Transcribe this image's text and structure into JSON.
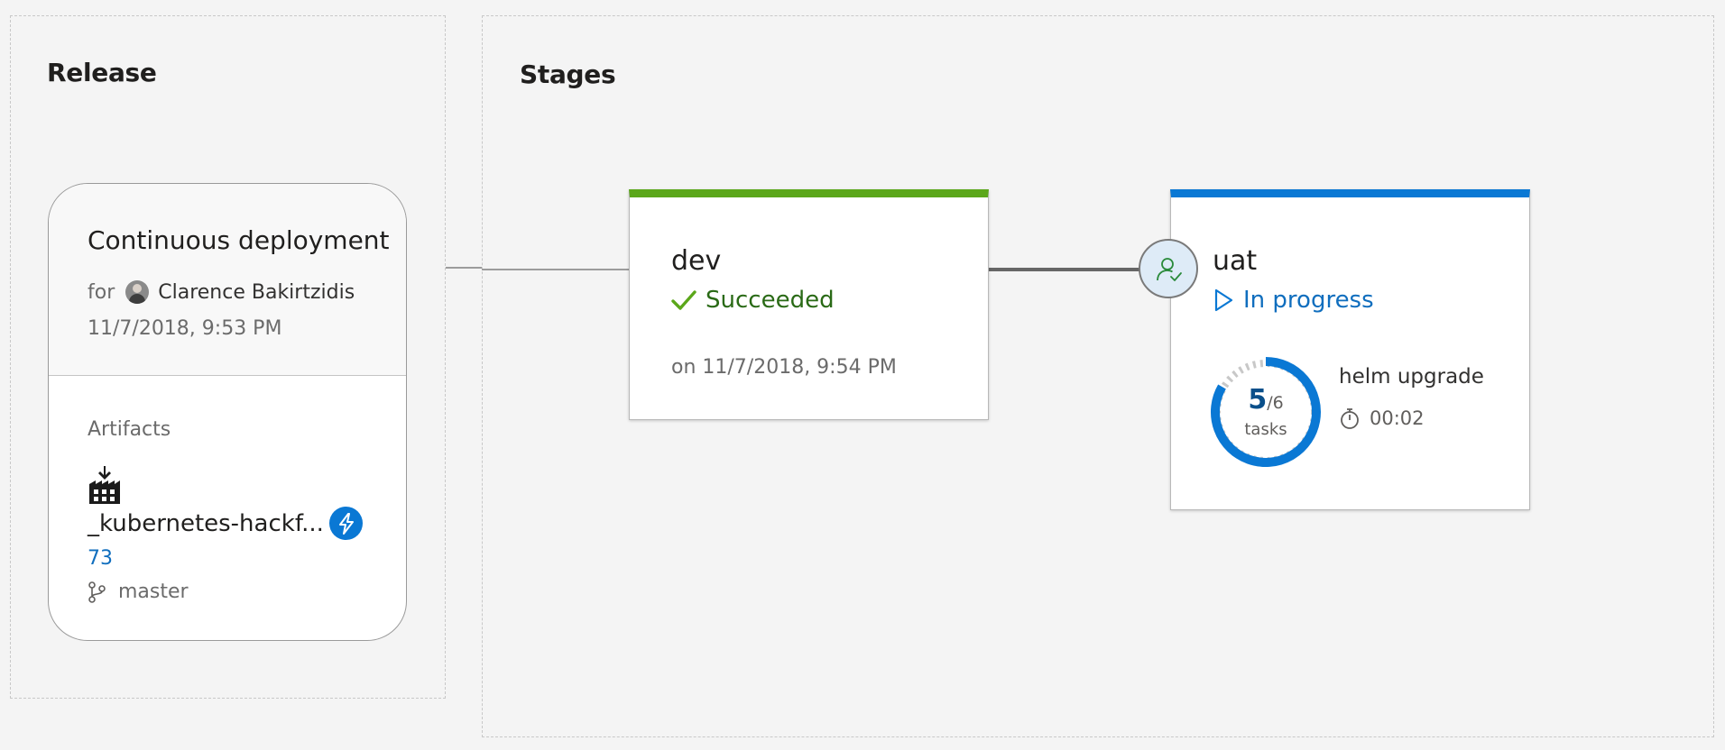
{
  "release": {
    "section_title": "Release",
    "trigger_title": "Continuous deployment",
    "for_label": "for",
    "author": "Clarence Bakirtzidis",
    "created": "11/7/2018, 9:53 PM",
    "artifacts_label": "Artifacts",
    "artifact": {
      "name": "_kubernetes-hackf...",
      "build_number": "73",
      "branch": "master",
      "icon": "build-pipeline-icon",
      "trigger_icon": "lightning-icon"
    }
  },
  "stages": {
    "section_title": "Stages",
    "items": [
      {
        "name": "dev",
        "status": "Succeeded",
        "status_icon": "checkmark-icon",
        "completed": "on 11/7/2018, 9:54 PM",
        "accent_color": "#5ba71a"
      },
      {
        "name": "uat",
        "status": "In progress",
        "status_icon": "play-icon",
        "pre_approval_icon": "user-approved-icon",
        "accent_color": "#0a78d4",
        "progress": {
          "done": "5",
          "total": "/6",
          "unit": "tasks",
          "fraction": 0.8333
        },
        "current_task": "helm upgrade",
        "elapsed": "00:02"
      }
    ]
  },
  "colors": {
    "background": "#f4f4f4",
    "success": "#5ba71a",
    "in_progress": "#0a78d4",
    "link": "#106ebe"
  }
}
